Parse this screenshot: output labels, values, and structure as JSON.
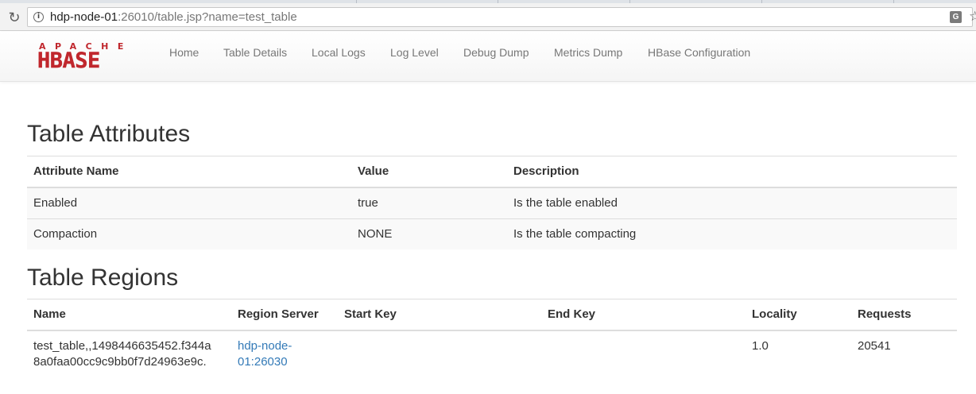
{
  "browser": {
    "url_host": "hdp-node-01",
    "url_rest": ":26010/table.jsp?name=test_table"
  },
  "logo": {
    "top": "APACHE",
    "main": "HBASE",
    "color": "#c0272d"
  },
  "nav": {
    "items": [
      "Home",
      "Table Details",
      "Local Logs",
      "Log Level",
      "Debug Dump",
      "Metrics Dump",
      "HBase Configuration"
    ]
  },
  "attributes": {
    "title": "Table Attributes",
    "headers": [
      "Attribute Name",
      "Value",
      "Description"
    ],
    "rows": [
      [
        "Enabled",
        "true",
        "Is the table enabled"
      ],
      [
        "Compaction",
        "NONE",
        "Is the table compacting"
      ]
    ]
  },
  "regions": {
    "title": "Table Regions",
    "headers": [
      "Name",
      "Region Server",
      "Start Key",
      "End Key",
      "Locality",
      "Requests"
    ],
    "rows": [
      {
        "name_line1": "test_table,,1498446635452.f344a",
        "name_line2": "8a0faa00cc9c9bb0f7d24963e9c.",
        "server_line1": "hdp-node-",
        "server_line2": "01:26030",
        "start_key": "",
        "end_key": "",
        "locality": "1.0",
        "requests": "20541"
      }
    ]
  },
  "colors": {
    "link": "#337ab7",
    "border": "#dddddd",
    "stripe": "#f9f9f9"
  }
}
